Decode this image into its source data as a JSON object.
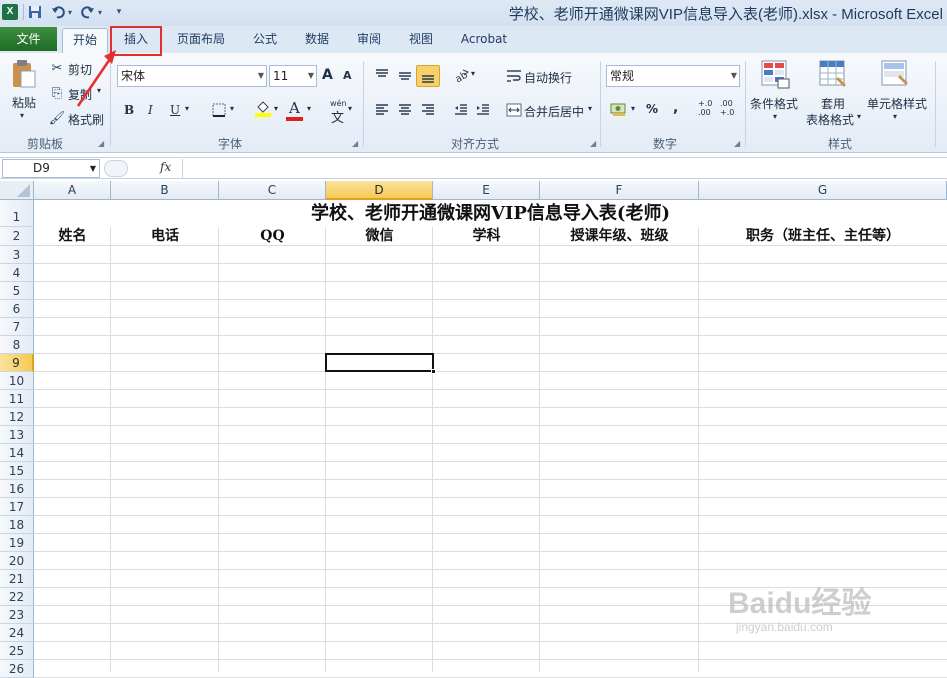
{
  "window": {
    "title": "学校、老师开通微课网VIP信息导入表(老师).xlsx - Microsoft Excel",
    "app_icon": "X"
  },
  "tabs": [
    {
      "label": "文件"
    },
    {
      "label": "开始"
    },
    {
      "label": "插入"
    },
    {
      "label": "页面布局"
    },
    {
      "label": "公式"
    },
    {
      "label": "数据"
    },
    {
      "label": "审阅"
    },
    {
      "label": "视图"
    },
    {
      "label": "Acrobat"
    }
  ],
  "ribbon": {
    "clipboard": {
      "paste": "粘贴",
      "cut": "剪切",
      "copy": "复制",
      "format_painter": "格式刷",
      "label": "剪贴板"
    },
    "font": {
      "name": "宋体",
      "size": "11",
      "bold": "B",
      "italic": "I",
      "underline": "U",
      "label": "字体",
      "grow": "A",
      "shrink": "A",
      "font_color": "A",
      "phonetic": "wén"
    },
    "alignment": {
      "wrap": "自动换行",
      "merge": "合并后居中",
      "label": "对齐方式"
    },
    "number": {
      "format": "常规",
      "percent": "%",
      "comma": ",",
      "inc_dec": "+.0\n.00",
      "dec_dec": ".00\n+.0",
      "label": "数字"
    },
    "styles": {
      "conditional": "条件格式",
      "table_line1": "套用",
      "table_line2": "表格格式",
      "cell_styles": "单元格样式",
      "label": "样式"
    },
    "accent_file": "#2b7a30",
    "highlight_color": "#e52e2e"
  },
  "formula_bar": {
    "name_box": "D9",
    "fx": "fx",
    "value": ""
  },
  "sheet": {
    "columns": [
      "A",
      "B",
      "C",
      "D",
      "E",
      "F",
      "G"
    ],
    "rows": [
      "1",
      "2",
      "3",
      "4",
      "5",
      "6",
      "7",
      "8",
      "9",
      "10",
      "11",
      "12",
      "13",
      "14",
      "15",
      "16",
      "17",
      "18",
      "19",
      "20",
      "21",
      "22",
      "23",
      "24",
      "25",
      "26"
    ],
    "selected_cell": "D9",
    "title": "学校、老师开通微课网VIP信息导入表(老师)",
    "headers": [
      "姓名",
      "电话",
      "QQ",
      "微信",
      "学科",
      "授课年级、班级",
      "职务（班主任、主任等）"
    ]
  },
  "watermark": {
    "brand": "Baidu经验",
    "url": "jingyan.baidu.com"
  }
}
